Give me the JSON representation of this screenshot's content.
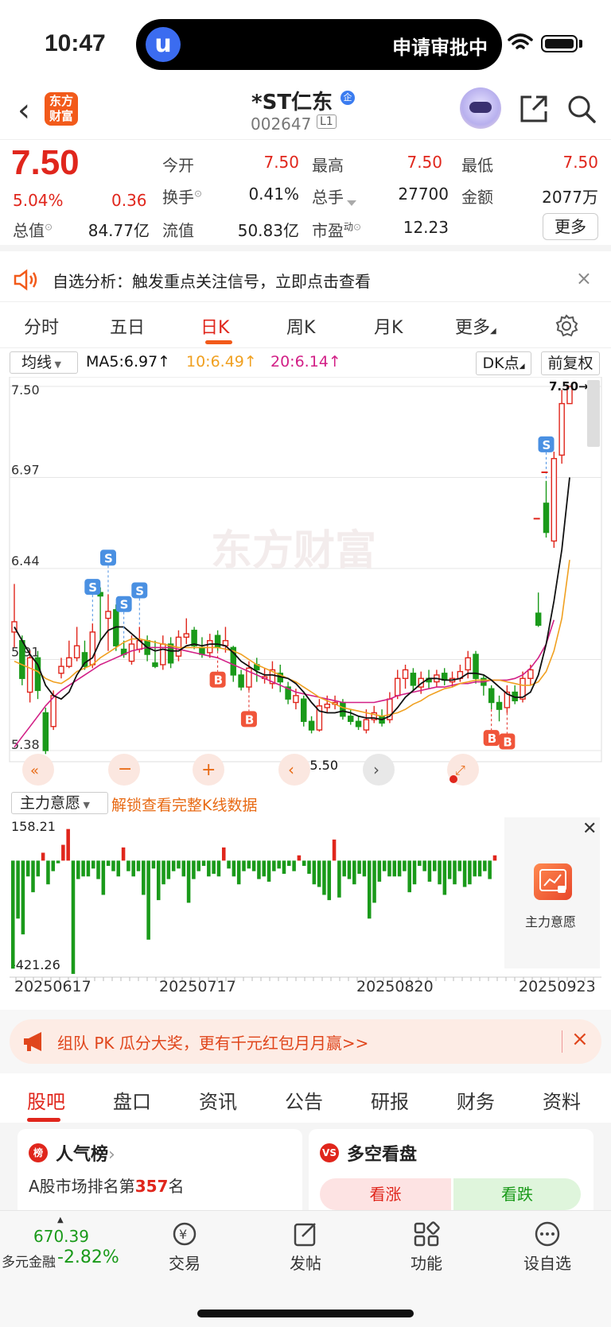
{
  "status": {
    "time": "10:47",
    "island_logo": "u",
    "island_text": "申请审批中"
  },
  "header": {
    "app_logo": "东方财富",
    "name": "*ST仁东",
    "name_badge": "企",
    "code": "002647",
    "level": "L1"
  },
  "quote": {
    "price": "7.50",
    "pct": "5.04%",
    "change": "0.36",
    "open_label": "今开",
    "open": "7.50",
    "high_label": "最高",
    "high": "7.50",
    "low_label": "最低",
    "low": "7.50",
    "turnover_label": "换手",
    "turnover": "0.41%",
    "volume_label": "总手",
    "volume": "27700",
    "amount_label": "金额",
    "amount": "2077万",
    "mcap_label": "总值",
    "mcap": "84.77亿",
    "float_label": "流值",
    "float": "50.83亿",
    "pe_label": "市盈",
    "pe_sup": "动",
    "pe": "12.23",
    "more": "更多"
  },
  "banner": {
    "text": "自选分析：触发重点关注信号，立即点击查看",
    "close": "×"
  },
  "tabs": [
    "分时",
    "五日",
    "日K",
    "周K",
    "月K",
    "更多"
  ],
  "active_tab": 2,
  "ma": {
    "select": "均线",
    "ma5": "MA5:6.97↑",
    "ma10": "10:6.49↑",
    "ma20": "20:6.14↑",
    "dk": "DK点",
    "fq": "前复权"
  },
  "colors": {
    "up": "#e0261c",
    "down": "#1a9a1a",
    "ma5": "#111111",
    "ma10": "#f0a020",
    "ma20": "#d21f86",
    "accent": "#f25a1a"
  },
  "chart_data": {
    "type": "candlestick",
    "y_ticks": [
      "7.50",
      "6.97",
      "6.44",
      "5.91",
      "5.38"
    ],
    "last_price_label": "7.50→",
    "low_label": "←5.50",
    "watermark": "东方财富",
    "markers": {
      "sell": "S",
      "buy": "B"
    },
    "ylim": [
      5.38,
      7.5
    ],
    "candles": [
      [
        6.07,
        6.13,
        6.35,
        5.98
      ],
      [
        6.02,
        5.8,
        6.05,
        5.76
      ],
      [
        5.72,
        5.92,
        5.96,
        5.66
      ],
      [
        5.92,
        5.73,
        5.96,
        5.68
      ],
      [
        5.6,
        5.38,
        5.63,
        5.36
      ],
      [
        5.52,
        5.7,
        5.73,
        5.5
      ],
      [
        5.83,
        5.87,
        5.92,
        5.8
      ],
      [
        5.87,
        5.92,
        6.02,
        5.86
      ],
      [
        5.92,
        5.99,
        6.1,
        5.9
      ],
      [
        5.95,
        5.87,
        6.02,
        5.85
      ],
      [
        5.88,
        6.07,
        6.12,
        5.86
      ],
      [
        6.3,
        6.28,
        6.33,
        6.02
      ],
      [
        6.15,
        6.19,
        6.29,
        5.96
      ],
      [
        6.2,
        5.99,
        6.23,
        5.96
      ],
      [
        5.97,
        5.94,
        6.02,
        5.92
      ],
      [
        5.9,
        6.0,
        6.05,
        5.88
      ],
      [
        5.97,
        6.02,
        6.1,
        5.95
      ],
      [
        6.02,
        5.94,
        6.05,
        5.9
      ],
      [
        5.89,
        5.87,
        6.02,
        5.86
      ],
      [
        5.88,
        6.0,
        6.05,
        5.85
      ],
      [
        6.0,
        5.89,
        6.04,
        5.86
      ],
      [
        5.93,
        6.04,
        6.08,
        5.9
      ],
      [
        6.04,
        6.06,
        6.15,
        6.0
      ],
      [
        6.08,
        5.99,
        6.1,
        5.97
      ],
      [
        5.98,
        5.94,
        6.04,
        5.92
      ],
      [
        5.95,
        6.02,
        6.06,
        5.92
      ],
      [
        6.05,
        5.98,
        6.08,
        5.96
      ],
      [
        5.99,
        6.02,
        6.1,
        5.95
      ],
      [
        5.98,
        5.82,
        5.99,
        5.78
      ],
      [
        5.82,
        5.75,
        5.85,
        5.73
      ],
      [
        5.75,
        5.86,
        5.9,
        5.73
      ],
      [
        5.88,
        5.85,
        5.92,
        5.78
      ],
      [
        5.8,
        5.81,
        5.86,
        5.77
      ],
      [
        5.77,
        5.85,
        5.9,
        5.74
      ],
      [
        5.83,
        5.78,
        5.88,
        5.72
      ],
      [
        5.75,
        5.68,
        5.78,
        5.65
      ],
      [
        5.66,
        5.7,
        5.74,
        5.62
      ],
      [
        5.68,
        5.55,
        5.7,
        5.52
      ],
      [
        5.55,
        5.5,
        5.58,
        5.48
      ],
      [
        5.5,
        5.64,
        5.68,
        5.49
      ],
      [
        5.63,
        5.65,
        5.7,
        5.6
      ],
      [
        5.65,
        5.66,
        5.7,
        5.62
      ],
      [
        5.66,
        5.58,
        5.68,
        5.56
      ],
      [
        5.58,
        5.55,
        5.62,
        5.53
      ],
      [
        5.55,
        5.52,
        5.58,
        5.5
      ],
      [
        5.5,
        5.56,
        5.62,
        5.48
      ],
      [
        5.56,
        5.6,
        5.64,
        5.54
      ],
      [
        5.58,
        5.54,
        5.62,
        5.52
      ],
      [
        5.56,
        5.68,
        5.72,
        5.54
      ],
      [
        5.7,
        5.8,
        5.85,
        5.68
      ],
      [
        5.8,
        5.85,
        5.88,
        5.74
      ],
      [
        5.83,
        5.76,
        5.86,
        5.73
      ],
      [
        5.75,
        5.8,
        5.84,
        5.71
      ],
      [
        5.8,
        5.78,
        5.85,
        5.74
      ],
      [
        5.78,
        5.82,
        5.85,
        5.75
      ],
      [
        5.83,
        5.79,
        5.86,
        5.76
      ],
      [
        5.78,
        5.8,
        5.84,
        5.75
      ],
      [
        5.8,
        5.84,
        5.88,
        5.78
      ],
      [
        5.85,
        5.92,
        5.96,
        5.8
      ],
      [
        5.94,
        5.8,
        5.96,
        5.77
      ],
      [
        5.8,
        5.76,
        5.82,
        5.7
      ],
      [
        5.74,
        5.66,
        5.76,
        5.62
      ],
      [
        5.66,
        5.62,
        5.7,
        5.55
      ],
      [
        5.63,
        5.72,
        5.76,
        5.6
      ],
      [
        5.72,
        5.67,
        5.76,
        5.65
      ],
      [
        5.68,
        5.8,
        5.84,
        5.66
      ],
      [
        5.8,
        5.85,
        5.88,
        5.76
      ],
      [
        6.18,
        6.11,
        6.3,
        6.1
      ],
      [
        6.82,
        6.65,
        6.95,
        6.62
      ],
      [
        6.6,
        7.08,
        7.12,
        6.56
      ],
      [
        7.1,
        7.4,
        7.48,
        7.05
      ],
      [
        7.4,
        7.5,
        7.5,
        7.5
      ]
    ],
    "ma5": [
      6.1,
      6.02,
      5.94,
      5.88,
      5.76,
      5.7,
      5.68,
      5.72,
      5.82,
      5.89,
      5.92,
      6.02,
      6.08,
      6.1,
      6.1,
      6.06,
      6.02,
      5.98,
      5.96,
      5.97,
      5.96,
      5.96,
      5.99,
      6.0,
      5.99,
      6.0,
      6.0,
      5.99,
      5.95,
      5.9,
      5.87,
      5.84,
      5.82,
      5.82,
      5.81,
      5.8,
      5.77,
      5.72,
      5.66,
      5.61,
      5.6,
      5.6,
      5.61,
      5.6,
      5.58,
      5.57,
      5.57,
      5.56,
      5.58,
      5.63,
      5.69,
      5.73,
      5.77,
      5.8,
      5.8,
      5.79,
      5.79,
      5.8,
      5.83,
      5.83,
      5.82,
      5.79,
      5.75,
      5.71,
      5.69,
      5.69,
      5.72,
      5.82,
      6.0,
      6.25,
      6.55,
      6.97
    ],
    "ma10": [
      5.9,
      5.88,
      5.86,
      5.84,
      5.8,
      5.78,
      5.77,
      5.8,
      5.84,
      5.86,
      5.88,
      5.92,
      5.95,
      5.98,
      6.01,
      6.03,
      6.03,
      6.02,
      6.01,
      6.0,
      5.99,
      5.98,
      5.98,
      5.98,
      5.98,
      5.98,
      5.98,
      5.97,
      5.96,
      5.94,
      5.91,
      5.88,
      5.86,
      5.84,
      5.82,
      5.8,
      5.78,
      5.75,
      5.72,
      5.69,
      5.67,
      5.65,
      5.63,
      5.62,
      5.61,
      5.6,
      5.59,
      5.58,
      5.59,
      5.6,
      5.62,
      5.65,
      5.67,
      5.7,
      5.72,
      5.74,
      5.75,
      5.77,
      5.78,
      5.79,
      5.79,
      5.79,
      5.79,
      5.78,
      5.77,
      5.76,
      5.76,
      5.78,
      5.84,
      5.96,
      6.15,
      6.49
    ],
    "ma20": [
      5.4,
      5.46,
      5.52,
      5.58,
      5.64,
      5.69,
      5.73,
      5.76,
      5.79,
      5.82,
      5.85,
      5.88,
      5.9,
      5.92,
      5.94,
      5.96,
      5.97,
      5.98,
      5.98,
      5.98,
      5.98,
      5.97,
      5.96,
      5.95,
      5.94,
      5.93,
      5.92,
      5.9,
      5.88,
      5.86,
      5.84,
      5.82,
      5.8,
      5.78,
      5.76,
      5.74,
      5.72,
      5.71,
      5.7,
      5.69,
      5.68,
      5.67,
      5.66,
      5.66,
      5.66,
      5.66,
      5.66,
      5.67,
      5.68,
      5.7,
      5.71,
      5.72,
      5.73,
      5.74,
      5.75,
      5.75,
      5.76,
      5.77,
      5.77,
      5.78,
      5.78,
      5.79,
      5.79,
      5.79,
      5.8,
      5.82,
      5.86,
      5.92,
      6.0,
      6.14
    ]
  },
  "volume": {
    "select": "主力意愿",
    "unlock": "解锁查看完整K线数据",
    "max": "158.21",
    "min": "-421.26",
    "values": [
      -410,
      -220,
      -280,
      -60,
      -120,
      -60,
      30,
      -90,
      -40,
      -10,
      60,
      120,
      -430,
      -70,
      -60,
      -60,
      -30,
      -70,
      -130,
      -20,
      -40,
      -60,
      50,
      -40,
      -60,
      -40,
      -130,
      -300,
      -30,
      -150,
      -90,
      -70,
      -40,
      -30,
      -60,
      -160,
      -70,
      -40,
      -20,
      -60,
      -50,
      -60,
      50,
      -30,
      -60,
      -90,
      -40,
      -30,
      -40,
      -70,
      -60,
      -80,
      -40,
      -30,
      -50,
      -20,
      -40,
      20,
      -20,
      -50,
      -90,
      -100,
      -130,
      -150,
      80,
      -140,
      -60,
      -70,
      -90,
      -50,
      -60,
      -220,
      -160,
      -80,
      -40,
      -60,
      -60,
      -60,
      -40,
      -120,
      -90,
      -20,
      -40,
      -80,
      -40,
      -90,
      -130,
      -70,
      -90,
      -40,
      -100,
      -90,
      -60,
      -60,
      -40,
      -70,
      20
    ],
    "panel_label": "主力意愿"
  },
  "dates": [
    "20250617",
    "20250717",
    "20250820",
    "20250923"
  ],
  "promo": {
    "text": "组队 PK 瓜分大奖，更有千元红包月月赢>>",
    "close": "×"
  },
  "bottom_tabs": [
    "股吧",
    "盘口",
    "资讯",
    "公告",
    "研报",
    "财务",
    "资料"
  ],
  "cards": {
    "popularity": {
      "icon": "榜",
      "title": "人气榜",
      "arrow": "›",
      "rank_prefix": "A股市场排名第",
      "rank": "357",
      "rank_suffix": "名"
    },
    "sentiment": {
      "icon": "VS",
      "title": "多空看盘",
      "bull": "看涨",
      "bear": "看跌"
    }
  },
  "bottom_nav": {
    "index_value": "670.39",
    "index_name": "多元金融",
    "index_change": "-2.82%",
    "items": [
      "交易",
      "发帖",
      "功能",
      "设自选"
    ]
  }
}
